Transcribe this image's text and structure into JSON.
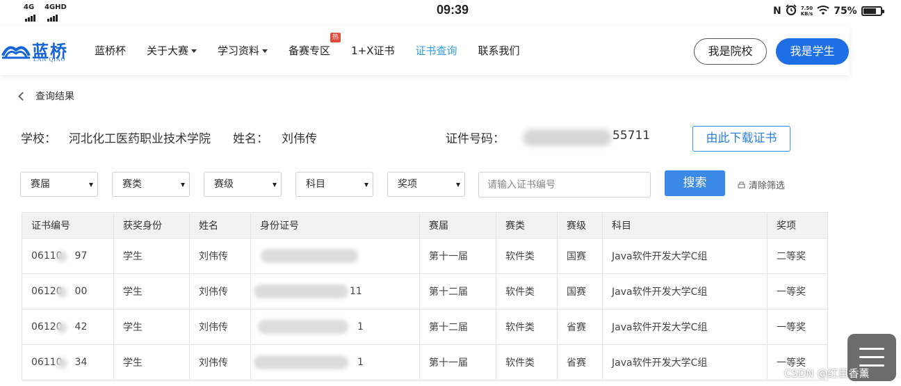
{
  "status": {
    "net1": "4G",
    "net2": "4GHD",
    "time": "09:39",
    "nfc_icon": "nfc-icon",
    "speed_top": "7.50",
    "speed_bottom": "KB/s",
    "battery_text": "75%",
    "battery_level": 0.75
  },
  "brand": {
    "name": "蓝桥",
    "sub": "LAN QIAO",
    "color": "#1565d8"
  },
  "nav": {
    "items": [
      "蓝桥杯",
      "关于大赛",
      "学习资料",
      "备赛专区",
      "1+X证书",
      "证书查询",
      "联系我们"
    ],
    "hot_badge": "热"
  },
  "auth": {
    "school_label": "我是院校",
    "student_label": "我是学生"
  },
  "breadcrumb": {
    "label": "查询结果"
  },
  "info": {
    "school_label": "学校：",
    "school_value": "河北化工医药职业技术学院",
    "name_label": "姓名：",
    "name_value": "刘伟传",
    "cert_label": "证件号码：",
    "cert_tail": "55711",
    "download_label": "由此下载证书"
  },
  "filters": {
    "session": "赛届",
    "category": "赛类",
    "level": "赛级",
    "subject": "科目",
    "award": "奖项",
    "cert_placeholder": "请输入证书编号",
    "search_label": "搜索",
    "clear_label": "清除筛选"
  },
  "table": {
    "headers": [
      "证书编号",
      "获奖身份",
      "姓名",
      "身份证号",
      "赛届",
      "赛类",
      "赛级",
      "科目",
      "奖项"
    ],
    "rows": [
      {
        "cert_a": "06110",
        "cert_b": "97",
        "role": "学生",
        "name": "刘伟传",
        "id_tail": "",
        "session": "第十一届",
        "category": "软件类",
        "level": "国赛",
        "subject": "Java软件开发大学C组",
        "award": "二等奖"
      },
      {
        "cert_a": "06120",
        "cert_b": "00",
        "role": "学生",
        "name": "刘伟传",
        "id_tail": "11",
        "session": "第十二届",
        "category": "软件类",
        "level": "国赛",
        "subject": "Java软件开发大学C组",
        "award": "一等奖"
      },
      {
        "cert_a": "06120",
        "cert_b": "42",
        "role": "学生",
        "name": "刘伟传",
        "id_tail": "1",
        "session": "第十二届",
        "category": "软件类",
        "level": "省赛",
        "subject": "Java软件开发大学C组",
        "award": "一等奖"
      },
      {
        "cert_a": "06110",
        "cert_b": "34",
        "role": "学生",
        "name": "刘伟传",
        "id_tail": "1",
        "session": "第十一届",
        "category": "软件类",
        "level": "省赛",
        "subject": "Java软件开发大学C组",
        "award": "一等奖"
      }
    ]
  },
  "watermark": "CSDN @红目香薰",
  "colors": {
    "accent": "#1e6ee6",
    "active_nav": "#2f9be6",
    "hot": "#e64a3b",
    "search": "#3b89e6"
  }
}
